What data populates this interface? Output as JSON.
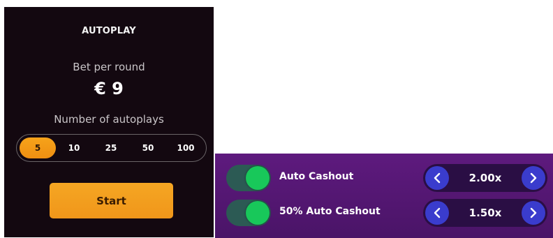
{
  "autoplay": {
    "title": "AUTOPLAY",
    "bet_label": "Bet per round",
    "bet_value": "€ 9",
    "count_label": "Number of autoplays",
    "options": [
      "5",
      "10",
      "25",
      "50",
      "100"
    ],
    "selected_option": "5",
    "start_label": "Start"
  },
  "auto_cashout": {
    "rows": [
      {
        "label": "Auto Cashout",
        "value": "2.00x",
        "enabled": true
      },
      {
        "label": "50% Auto Cashout",
        "value": "1.50x",
        "enabled": true
      }
    ]
  },
  "colors": {
    "panel_bg": "#130810",
    "accent_orange": "#f5a623",
    "cashout_bg": "#5e1a7e",
    "toggle_on": "#18c85a",
    "stepper_button": "#3a3ccd"
  },
  "icons": {
    "decrement": "chevron-left-icon",
    "increment": "chevron-right-icon"
  }
}
